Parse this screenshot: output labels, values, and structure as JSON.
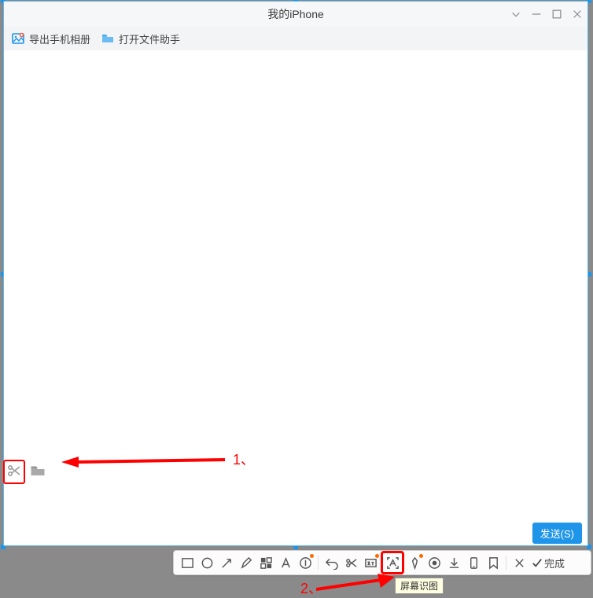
{
  "title": "我的iPhone",
  "toolbar": {
    "export_album": "导出手机相册",
    "open_file_helper": "打开文件助手"
  },
  "annotations": {
    "label1": "1、",
    "label2": "2、"
  },
  "send_button": "发送(S)",
  "screenshot_toolbar": {
    "done": "完成",
    "tooltip": "屏幕识图"
  }
}
